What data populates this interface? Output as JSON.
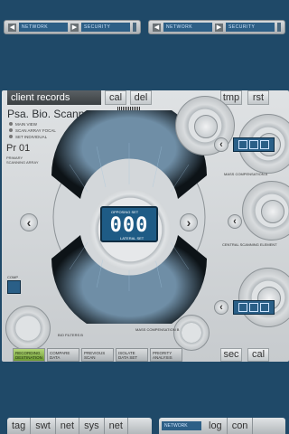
{
  "top_toolbars": [
    {
      "network": "NETWORK",
      "security": "SECURITY"
    },
    {
      "network": "NETWORK",
      "security": "SECURITY"
    }
  ],
  "panel": {
    "header_title": "client records",
    "header_buttons": [
      "cal",
      "del"
    ],
    "right_buttons": [
      "tmp",
      "rst"
    ],
    "title": "Psa. Bio. Scanner",
    "bio_filters_a": "BIO FILTERS A",
    "menu": [
      "MAIN VIEW",
      "SCAN ARRAY FOCAL",
      "SET INDIVIDUAL"
    ],
    "pr_label": "Pr 01",
    "pr_sub": "PRIMARY SCANNING ARRAY",
    "digits": "000",
    "opposing_set": "OPPOSING SET",
    "lateral_set": "LATERAL SET",
    "comp_label": "COMP",
    "bio_filters_b": "BIO FILTERS B",
    "mass_comp_a": "MASS COMPENSATION A",
    "central_scan": "CENTRAL SCANNING ELEMENT",
    "mass_comp_b": "MASS COMPENSATION B",
    "bottom_tabs": [
      "RECORDING DESTINATION",
      "COMPARE DATA",
      "PREVIOUS SCAN",
      "ISOLATE DATA SET",
      "PRIORITY ANALYSIS"
    ],
    "bottom_right_buttons": [
      "sec",
      "cal"
    ]
  },
  "dock": {
    "left": [
      "tag",
      "swt",
      "net",
      "sys",
      "net"
    ],
    "network_badge": "NETWORK",
    "right": [
      "log",
      "con"
    ]
  }
}
